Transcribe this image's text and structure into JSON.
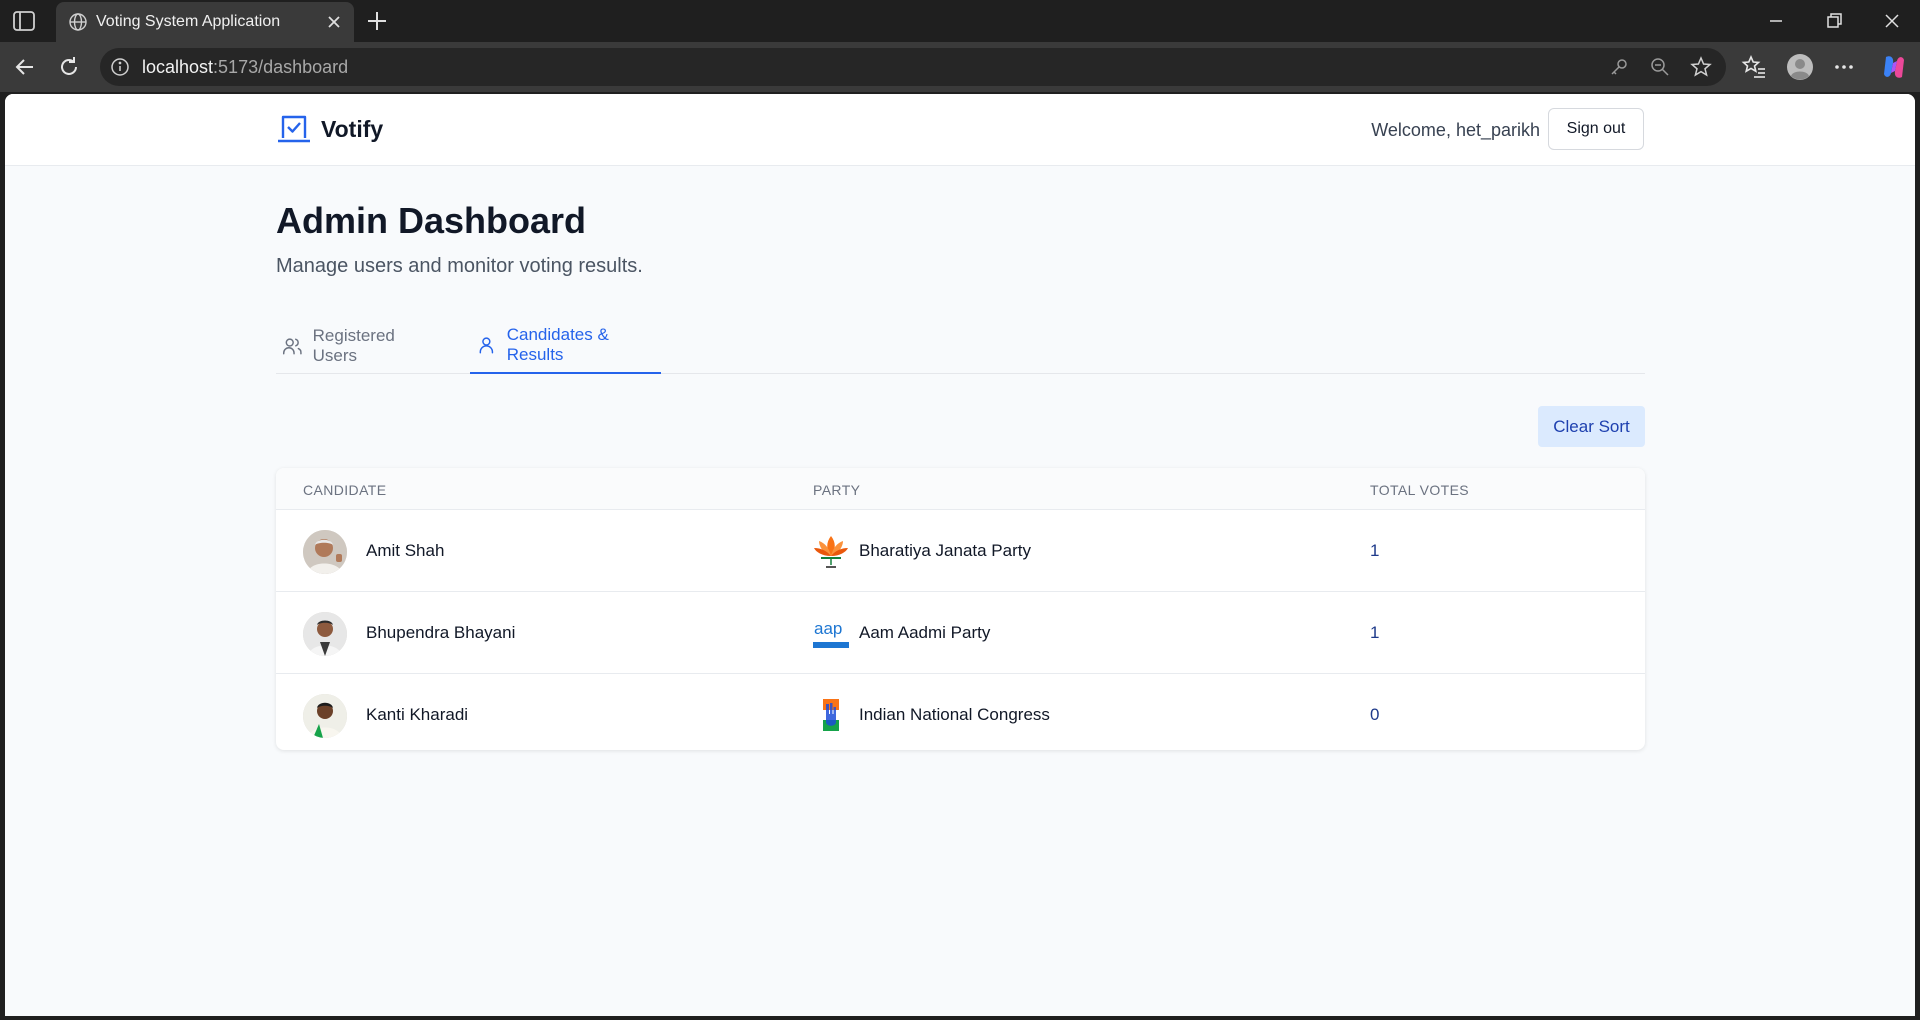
{
  "browser": {
    "tab_title": "Voting System Application",
    "url_host": "localhost",
    "url_rest": ":5173/dashboard"
  },
  "app": {
    "brand": "Votify",
    "welcome": "Welcome, het_parikh",
    "signout_label": "Sign out"
  },
  "page": {
    "title": "Admin Dashboard",
    "subtitle": "Manage users and monitor voting results."
  },
  "tabs": [
    {
      "label": "Registered Users",
      "icon": "users-icon",
      "active": false
    },
    {
      "label": "Candidates & Results",
      "icon": "user-icon",
      "active": true
    }
  ],
  "toolbar": {
    "clear_sort_label": "Clear Sort"
  },
  "table": {
    "headers": [
      "CANDIDATE",
      "PARTY",
      "TOTAL VOTES"
    ],
    "rows": [
      {
        "candidate": "Amit Shah",
        "party": "Bharatiya Janata Party",
        "party_logo": "lotus-logo",
        "votes": "1"
      },
      {
        "candidate": "Bhupendra Bhayani",
        "party": "Aam Aadmi Party",
        "party_logo": "aap-logo",
        "votes": "1"
      },
      {
        "candidate": "Kanti Kharadi",
        "party": "Indian National Congress",
        "party_logo": "hand-logo",
        "votes": "0"
      }
    ]
  },
  "colors": {
    "accent": "#2563eb",
    "chrome_bg": "#1f1f1f",
    "page_bg": "#f8fafc"
  }
}
